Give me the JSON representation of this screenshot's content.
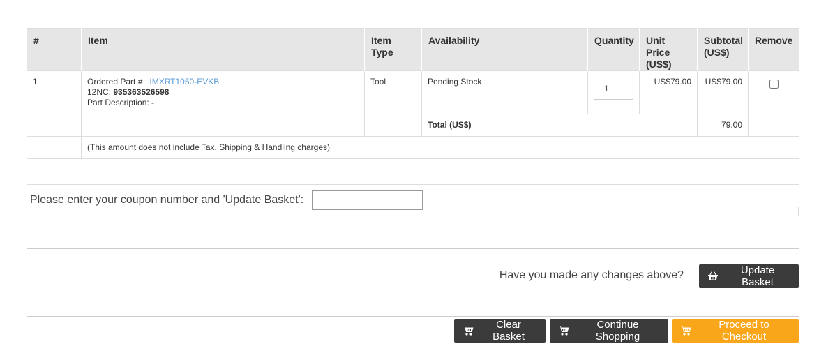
{
  "table": {
    "headers": {
      "num": "#",
      "item": "Item",
      "item_type": "Item Type",
      "availability": "Availability",
      "quantity": "Quantity",
      "unit_price": "Unit Price (US$)",
      "subtotal": "Subtotal (US$)",
      "remove": "Remove"
    },
    "rows": [
      {
        "num": "1",
        "ordered_part_label": "Ordered Part # :",
        "ordered_part_value": "IMXRT1050-EVKB",
        "nc_label": "12NC:",
        "nc_value": "935363526598",
        "description": "Part Description: -",
        "item_type": "Tool",
        "availability": "Pending Stock",
        "quantity": "1",
        "unit_price": "US$79.00",
        "subtotal": "US$79.00"
      }
    ],
    "total_label": "Total (US$)",
    "total_value": "79.00",
    "note": "(This amount does not include Tax, Shipping & Handling charges)"
  },
  "coupon": {
    "label": "Please enter your coupon number and 'Update Basket':",
    "value": ""
  },
  "update": {
    "question": "Have you made any changes above?",
    "button_label": "Update Basket"
  },
  "actions": {
    "clear_label": "Clear Basket",
    "continue_label": "Continue Shopping",
    "checkout_label": "Proceed to Checkout"
  },
  "colors": {
    "header_bg": "#e6e6e7",
    "link": "#5b9bd5",
    "dark_button": "#3b3b3b",
    "checkout_button": "#f9a61a"
  },
  "icons": {
    "update": "basket-icon",
    "cart": "cart-icon"
  }
}
